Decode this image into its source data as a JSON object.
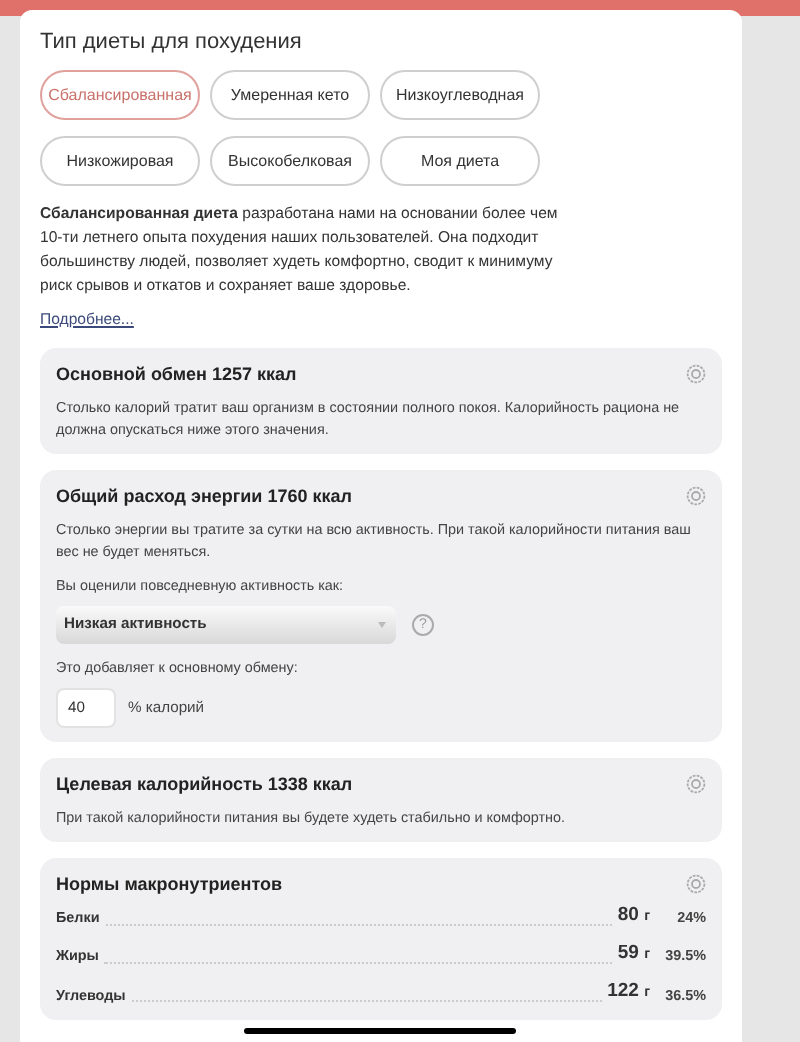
{
  "diet_section": {
    "title": "Тип диеты для похудения",
    "diets": [
      {
        "label": "Сбалансированная",
        "selected": true
      },
      {
        "label": "Умеренная кето",
        "selected": false
      },
      {
        "label": "Низкоуглеводная",
        "selected": false
      },
      {
        "label": "Низкожировая",
        "selected": false
      },
      {
        "label": "Высокобелковая",
        "selected": false
      },
      {
        "label": "Моя диета",
        "selected": false
      }
    ],
    "description": "**Сбалансированная диета** разработана нами на основании более чем 10-ти летнего опыта похудения наших пользователей. Она подходит большинству людей, позволяет худеть комфортно, сводит к минимуму риск срывов и откатов и сохраняет ваше здоровье.",
    "more_link": "Подробнее..."
  },
  "cards": [
    {
      "kind": "text",
      "title": "Основной обмен 1257 ккал",
      "text": "Столько калорий тратит ваш организм в состоянии полного покоя. Калорийность рациона не должна опускаться ниже этого значения."
    },
    {
      "kind": "activity",
      "title": "Общий расход энергии 1760 ккал",
      "text": "Столько энергии вы тратите за сутки на всю активность. При такой калорийности питания ваш вес не будет меняться.",
      "question": "Вы оценили повседневную активность как:",
      "select_value": "Низкая активность",
      "help": "?",
      "adds_label": "Это добавляет к основному обмену:",
      "percent_value": "40",
      "percent_unit": "% калорий"
    },
    {
      "kind": "text",
      "title": "Целевая калорийность 1338 ккал",
      "text": "При такой калорийности питания вы будете худеть стабильно и комфортно."
    },
    {
      "kind": "macros",
      "title": "Нормы макронутриентов",
      "rows": [
        {
          "name": "Белки",
          "amount": "80",
          "unit": "г",
          "percent": "24%"
        },
        {
          "name": "Жиры",
          "amount": "59",
          "unit": "г",
          "percent": "39.5%"
        },
        {
          "name": "Углеводы",
          "amount": "122",
          "unit": "г",
          "percent": "36.5%"
        }
      ]
    }
  ]
}
